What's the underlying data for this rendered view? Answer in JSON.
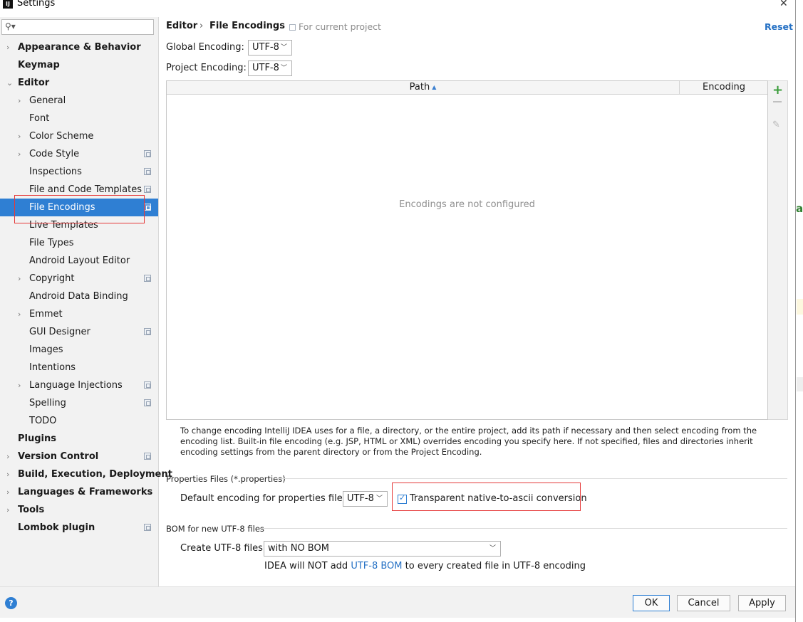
{
  "window": {
    "title": "Settings",
    "close_glyph": "✕"
  },
  "sidebar": {
    "search_placeholder": "",
    "items": [
      {
        "label": "Appearance & Behavior"
      },
      {
        "label": "Keymap"
      },
      {
        "label": "Editor"
      },
      {
        "label": "General"
      },
      {
        "label": "Font"
      },
      {
        "label": "Color Scheme"
      },
      {
        "label": "Code Style"
      },
      {
        "label": "Inspections"
      },
      {
        "label": "File and Code Templates"
      },
      {
        "label": "File Encodings"
      },
      {
        "label": "Live Templates"
      },
      {
        "label": "File Types"
      },
      {
        "label": "Android Layout Editor"
      },
      {
        "label": "Copyright"
      },
      {
        "label": "Android Data Binding"
      },
      {
        "label": "Emmet"
      },
      {
        "label": "GUI Designer"
      },
      {
        "label": "Images"
      },
      {
        "label": "Intentions"
      },
      {
        "label": "Language Injections"
      },
      {
        "label": "Spelling"
      },
      {
        "label": "TODO"
      },
      {
        "label": "Plugins"
      },
      {
        "label": "Version Control"
      },
      {
        "label": "Build, Execution, Deployment"
      },
      {
        "label": "Languages & Frameworks"
      },
      {
        "label": "Tools"
      },
      {
        "label": "Lombok plugin"
      }
    ]
  },
  "header": {
    "breadcrumb_parent": "Editor",
    "breadcrumb_sep": "›",
    "breadcrumb_current": "File Encodings",
    "scope_note": "For current project",
    "reset_label": "Reset"
  },
  "encodings": {
    "global_label": "Global Encoding:",
    "global_value": "UTF-8",
    "project_label": "Project Encoding:",
    "project_value": "UTF-8"
  },
  "table": {
    "col_path": "Path",
    "col_encoding": "Encoding",
    "empty_text": "Encodings are not configured"
  },
  "help_text": "To change encoding IntelliJ IDEA uses for a file, a directory, or the entire project, add its path if necessary and then select encoding from the encoding list. Built-in file encoding (e.g. JSP, HTML or XML) overrides encoding you specify here. If not specified, files and directories inherit encoding settings from the parent directory or from the Project Encoding.",
  "properties": {
    "section_title": "Properties Files (*.properties)",
    "default_label": "Default encoding for properties files:",
    "default_value": "UTF-8",
    "transparent_label": "Transparent native-to-ascii conversion",
    "transparent_checked": true
  },
  "bom": {
    "section_title": "BOM for new UTF-8 files",
    "create_label": "Create UTF-8 files:",
    "create_value": "with NO BOM",
    "note_before": "IDEA will NOT add ",
    "note_link": "UTF-8 BOM",
    "note_after": " to every created file in UTF-8 encoding"
  },
  "footer": {
    "help_glyph": "?",
    "ok_label": "OK",
    "cancel_label": "Cancel",
    "apply_label": "Apply"
  },
  "colors": {
    "accent": "#2f7fd3",
    "highlight_box": "#e53a3a",
    "link": "#2470c4"
  }
}
